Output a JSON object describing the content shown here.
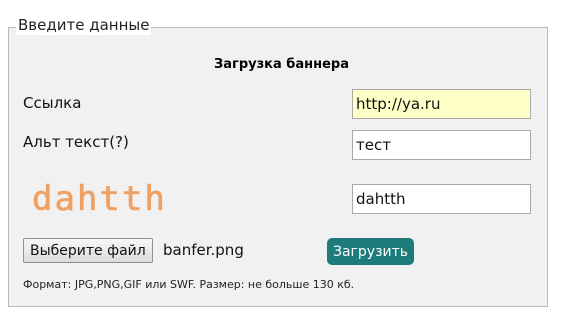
{
  "form": {
    "legend": "Введите данные",
    "title": "Загрузка баннера",
    "link": {
      "label": "Ссылка",
      "value": "http://ya.ru"
    },
    "alt": {
      "label": "Альт текст(?)",
      "value": "тест"
    },
    "captcha": {
      "image_text": "dahtth",
      "value": "dahtth",
      "color": "#f0a060"
    },
    "file": {
      "button_label": "Выберите файл",
      "file_name": "banfer.png"
    },
    "submit_label": "Загрузить",
    "note": "Формат: JPG,PNG,GIF или SWF. Размер: не больше 130 кб."
  }
}
